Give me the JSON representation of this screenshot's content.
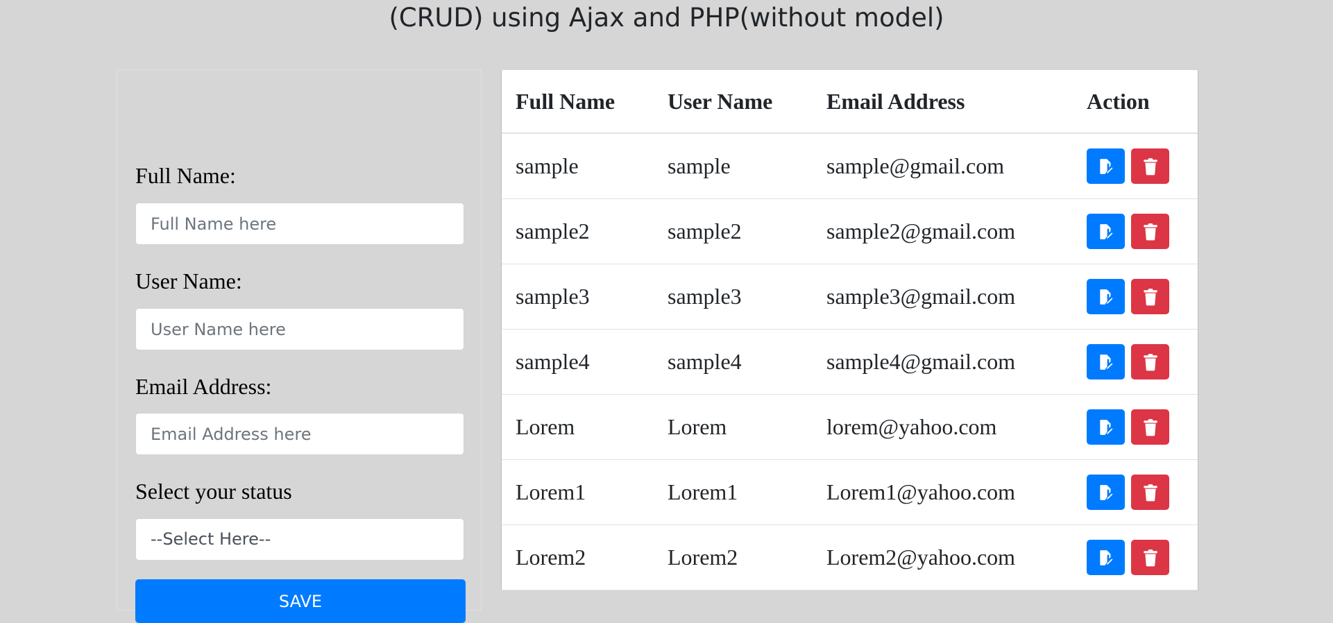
{
  "title": "(CRUD) using Ajax and PHP(without model)",
  "form": {
    "full_name_label": "Full Name:",
    "full_name_placeholder": "Full Name here",
    "user_name_label": "User Name:",
    "user_name_placeholder": "User Name here",
    "email_label": "Email Address:",
    "email_placeholder": "Email Address here",
    "status_label": "Select your status",
    "status_selected": "--Select Here--",
    "save_label": "SAVE"
  },
  "table": {
    "headers": [
      "Full Name",
      "User Name",
      "Email Address",
      "Action"
    ],
    "rows": [
      {
        "full_name": "sample",
        "user_name": "sample",
        "email": "sample@gmail.com"
      },
      {
        "full_name": "sample2",
        "user_name": "sample2",
        "email": "sample2@gmail.com"
      },
      {
        "full_name": "sample3",
        "user_name": "sample3",
        "email": "sample3@gmail.com"
      },
      {
        "full_name": "sample4",
        "user_name": "sample4",
        "email": "sample4@gmail.com"
      },
      {
        "full_name": "Lorem",
        "user_name": "Lorem",
        "email": "lorem@yahoo.com"
      },
      {
        "full_name": "Lorem1",
        "user_name": "Lorem1",
        "email": "Lorem1@yahoo.com"
      },
      {
        "full_name": "Lorem2",
        "user_name": "Lorem2",
        "email": "Lorem2@yahoo.com"
      }
    ]
  },
  "icons": {
    "edit": "edit-icon",
    "delete": "trash-icon"
  },
  "colors": {
    "background": "#d6d6d6",
    "primary": "#007bff",
    "danger": "#dc3545"
  }
}
